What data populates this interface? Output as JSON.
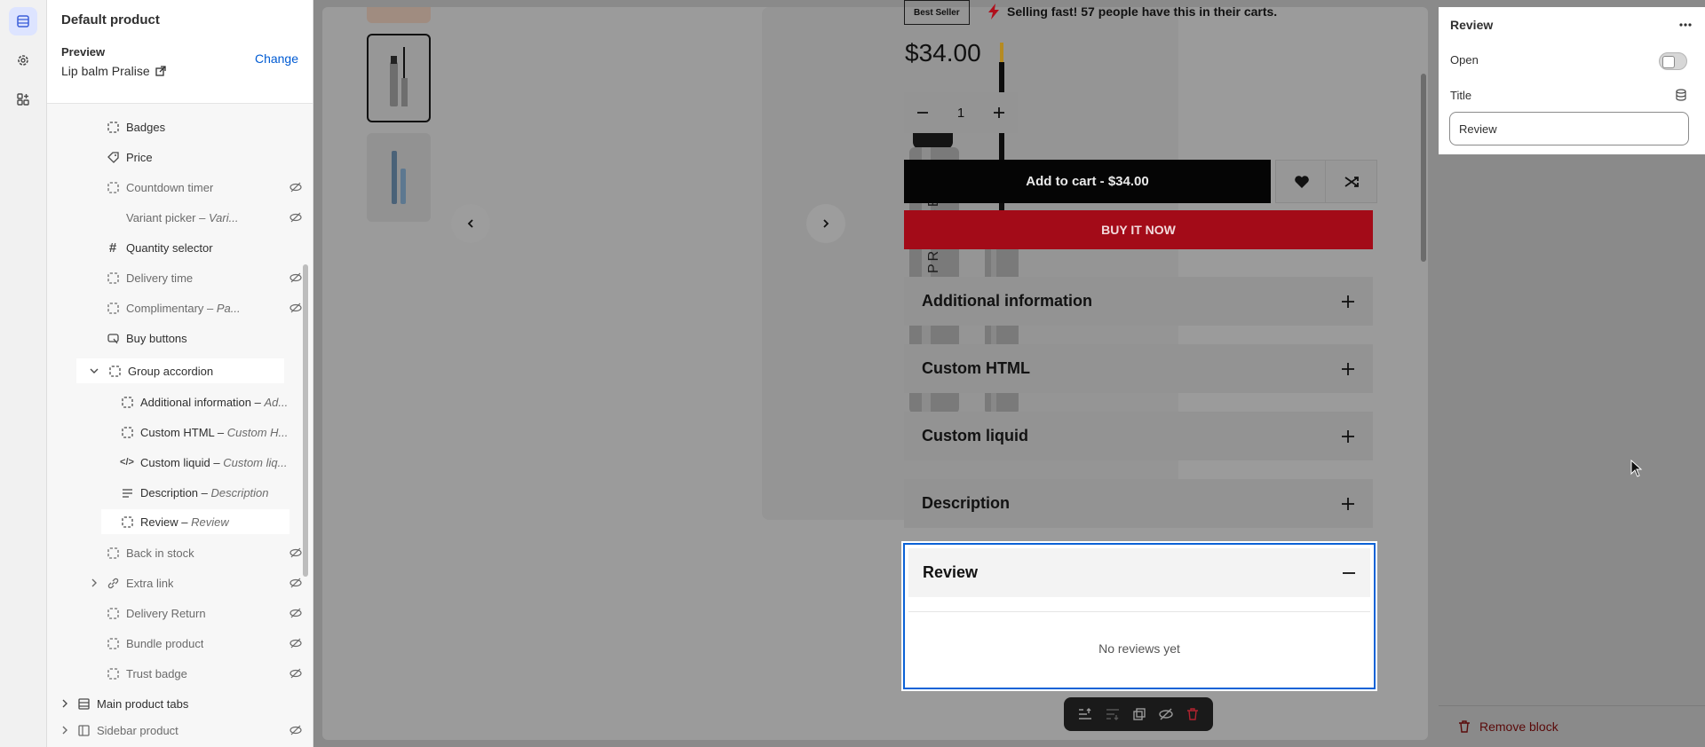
{
  "sidebar": {
    "title": "Default product",
    "preview_label": "Preview",
    "change_label": "Change",
    "product_name": "Lip balm Pralise",
    "items": [
      {
        "label": "Badges",
        "sub": "",
        "hidden": false
      },
      {
        "label": "Price",
        "sub": "",
        "hidden": false
      },
      {
        "label": "Countdown timer",
        "sub": "",
        "hidden": true
      },
      {
        "label": "Variant picker – ",
        "sub": "Vari...",
        "hidden": true
      },
      {
        "label": "Quantity selector",
        "sub": "",
        "hidden": false
      },
      {
        "label": "Delivery time",
        "sub": "",
        "hidden": true
      },
      {
        "label": "Complimentary – ",
        "sub": "Pa...",
        "hidden": true
      },
      {
        "label": "Buy buttons",
        "sub": "",
        "hidden": false
      },
      {
        "label": "Group accordion",
        "sub": "",
        "hidden": false
      },
      {
        "label": "Additional information – ",
        "sub": "Ad...",
        "hidden": false
      },
      {
        "label": "Custom HTML – ",
        "sub": "Custom H...",
        "hidden": false
      },
      {
        "label": "Custom liquid – ",
        "sub": "Custom liq...",
        "hidden": false
      },
      {
        "label": "Description – ",
        "sub": "Description",
        "hidden": false
      },
      {
        "label": "Review – ",
        "sub": "Review",
        "hidden": false
      },
      {
        "label": "Back in stock",
        "sub": "",
        "hidden": true
      },
      {
        "label": "Extra link",
        "sub": "",
        "hidden": true
      },
      {
        "label": "Delivery Return",
        "sub": "",
        "hidden": true
      },
      {
        "label": "Bundle product",
        "sub": "",
        "hidden": true
      },
      {
        "label": "Trust badge",
        "sub": "",
        "hidden": true
      },
      {
        "label": "Main product tabs",
        "sub": "",
        "hidden": false
      },
      {
        "label": "Sidebar product",
        "sub": "",
        "hidden": true
      }
    ]
  },
  "product": {
    "badge": "Best Seller",
    "selling_fast": "Selling fast! 57 people have this in their carts.",
    "price": "$34.00",
    "quantity": "1",
    "add_to_cart": "Add to cart",
    "add_to_cart_price": "$34.00",
    "buy_now": "BUY IT NOW",
    "gallery_brand": "PRALISE",
    "accordions": [
      "Additional information",
      "Custom HTML",
      "Custom liquid",
      "Description"
    ],
    "review_title": "Review",
    "review_empty": "No reviews yet"
  },
  "settings": {
    "block_title": "Review",
    "open_label": "Open",
    "title_label": "Title",
    "title_value": "Review",
    "remove_label": "Remove block"
  },
  "colors": {
    "accent": "#005bd3",
    "buy_now": "#a30b18",
    "selection_outline": "#0b62d6"
  }
}
